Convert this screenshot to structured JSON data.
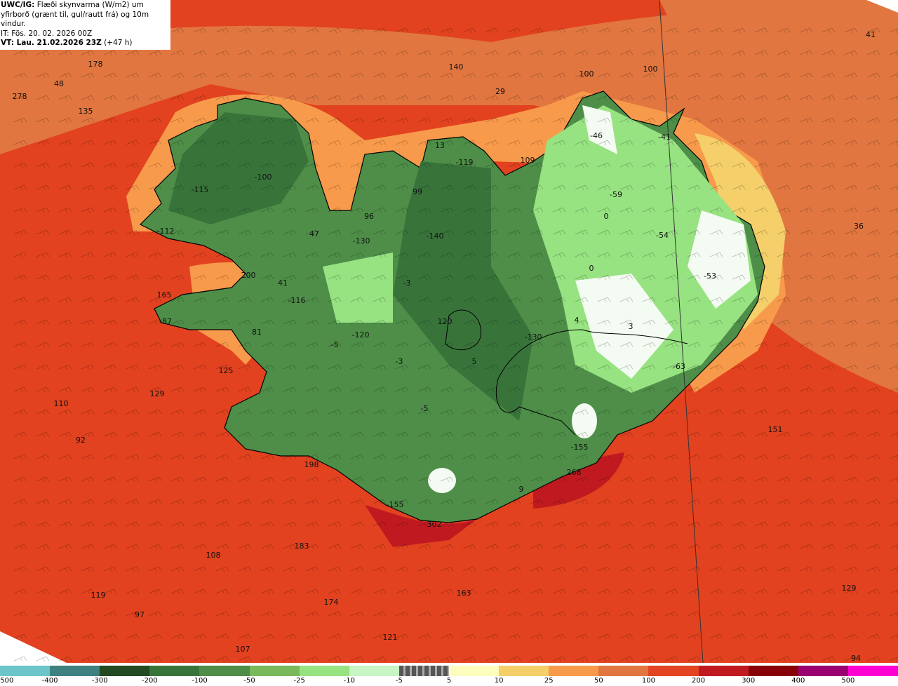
{
  "header": {
    "model": "UWC/IG:",
    "title_line1": "Flæði skynvarma (W/m2) um",
    "title_line2": "yfirborð (grænt til, gul/rautt frá) og 10m vindur.",
    "init_time": "IT: Fös. 20. 02. 2026 00Z",
    "valid_label": "VT: Lau. 21.02.2026 23Z",
    "lead_time": "(+47 h)"
  },
  "colorbar": {
    "ticks": [
      "-500",
      "-400",
      "-300",
      "-200",
      "-100",
      "-50",
      "-25",
      "-10",
      "-5",
      "5",
      "10",
      "25",
      "50",
      "100",
      "200",
      "300",
      "400",
      "500"
    ],
    "colors": [
      "#6cc5c8",
      "#3f8080",
      "#234a22",
      "#38743a",
      "#4e8e48",
      "#79b95c",
      "#97e281",
      "#c7f5c6",
      "checker",
      "#fdfdbd",
      "#f5cf6a",
      "#f89a4b",
      "#e17640",
      "#e24424",
      "#c01a20",
      "#870008",
      "#990071",
      "#ff00d2"
    ]
  },
  "map": {
    "ocean_color": "#e2421f",
    "land_color": "#4e8e48",
    "values": [
      "178",
      "48",
      "278",
      "135",
      "140",
      "100",
      "100",
      "41",
      "29",
      "13",
      "-119",
      "109",
      "-46",
      "-41",
      "-100",
      "-115",
      "99",
      "-59",
      "96",
      "0",
      "36",
      "-112",
      "47",
      "-130",
      "-140",
      "-54",
      "0",
      "-53",
      "200",
      "41",
      "-3",
      "165",
      "-116",
      "-87",
      "120",
      "4",
      "3",
      "81",
      "-120",
      "-5",
      "-130",
      "-3",
      "5",
      "-63",
      "125",
      "129",
      "110",
      "-5",
      "151",
      "92",
      "-155",
      "198",
      "268",
      "9",
      "-155",
      "302",
      "183",
      "108",
      "163",
      "129",
      "119",
      "174",
      "97",
      "121",
      "107",
      "94"
    ]
  }
}
